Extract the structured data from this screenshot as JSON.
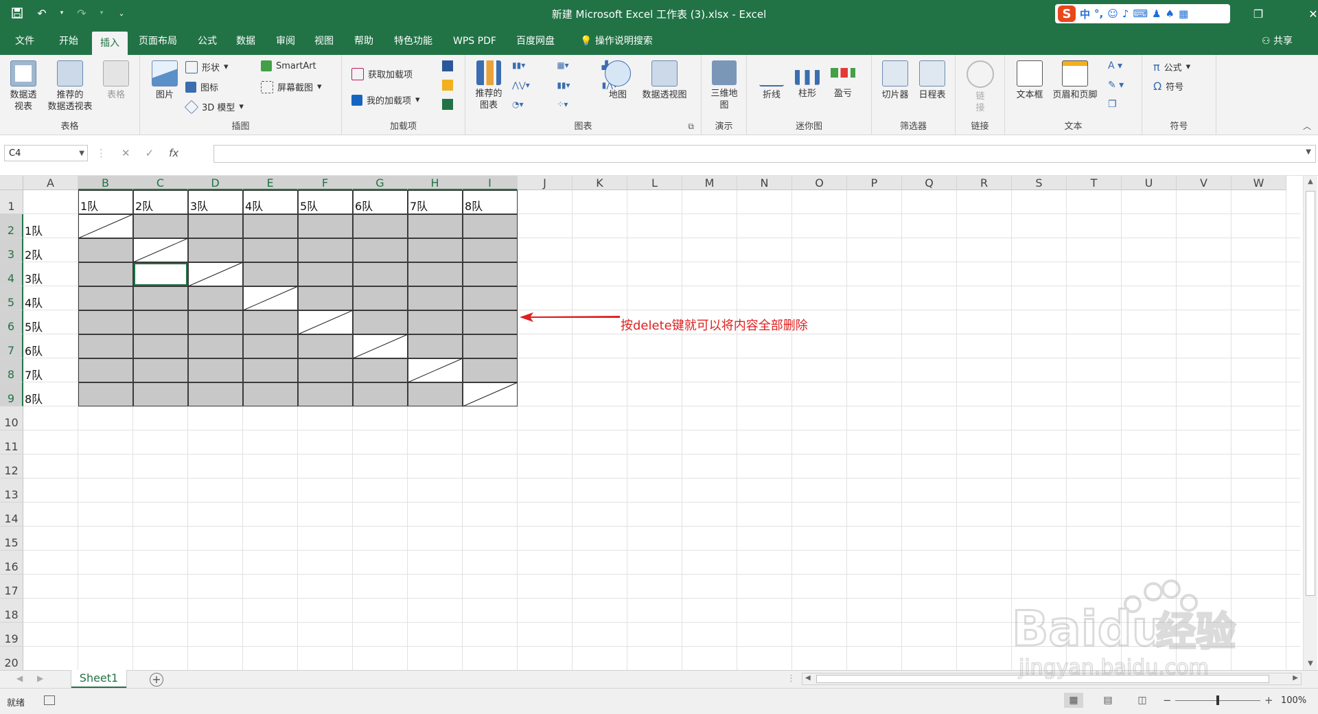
{
  "window": {
    "title": "新建 Microsoft Excel 工作表 (3).xlsx  -  Excel",
    "qat": [
      "save-icon",
      "undo-icon",
      "redo-icon",
      "customize-icon"
    ],
    "ime_logo": "S",
    "ime_label": "中",
    "ime_icons": [
      "°,",
      "☺",
      "🎤",
      "⌨",
      "👤",
      "👕",
      "▦"
    ]
  },
  "tabs": [
    "文件",
    "开始",
    "插入",
    "页面布局",
    "公式",
    "数据",
    "审阅",
    "视图",
    "帮助",
    "特色功能",
    "WPS PDF",
    "百度网盘"
  ],
  "active_tab": "插入",
  "tell_me": "操作说明搜索",
  "share": "共享",
  "ribbon": {
    "groups": {
      "tables": {
        "label": "表格",
        "pivot": "数据透\n视表",
        "recommended_pivot": "推荐的\n数据透视表",
        "table": "表格"
      },
      "illustrations": {
        "label": "插图",
        "picture": "图片",
        "shapes": "形状",
        "icons": "图标",
        "model3d": "3D 模型",
        "smartart": "SmartArt",
        "screenshot": "屏幕截图"
      },
      "addins": {
        "label": "加载项",
        "get": "获取加载项",
        "mine": "我的加载项"
      },
      "charts": {
        "label": "图表",
        "recommended": "推荐的\n图表",
        "maps": "地图",
        "pivotchart": "数据透视图"
      },
      "tours": {
        "label": "演示",
        "map3d": "三维地\n图"
      },
      "sparklines": {
        "label": "迷你图",
        "line": "折线",
        "column": "柱形",
        "winloss": "盈亏"
      },
      "filters": {
        "label": "筛选器",
        "slicer": "切片器",
        "timeline": "日程表"
      },
      "links": {
        "label": "链接",
        "link": "链\n接"
      },
      "text": {
        "label": "文本",
        "textbox": "文本框",
        "headerfooter": "页眉和页脚"
      },
      "symbols": {
        "label": "符号",
        "equation": "公式",
        "symbol": "符号"
      }
    }
  },
  "formula_bar": {
    "name_box": "C4",
    "fx": "fx",
    "content": ""
  },
  "columns": [
    "A",
    "B",
    "C",
    "D",
    "E",
    "F",
    "G",
    "H",
    "I",
    "J",
    "K",
    "L",
    "M",
    "N",
    "O",
    "P",
    "Q",
    "R",
    "S",
    "T",
    "U",
    "V",
    "W"
  ],
  "selected_columns": [
    "B",
    "C",
    "D",
    "E",
    "F",
    "G",
    "H",
    "I"
  ],
  "rows": [
    "1",
    "2",
    "3",
    "4",
    "5",
    "6",
    "7",
    "8",
    "9",
    "10",
    "11",
    "12",
    "13",
    "14",
    "15",
    "16",
    "17",
    "18",
    "19",
    "20"
  ],
  "selected_rows": [
    "2",
    "3",
    "4",
    "5",
    "6",
    "7",
    "8",
    "9"
  ],
  "table": {
    "header_row": [
      "1队",
      "2队",
      "3队",
      "4队",
      "5队",
      "6队",
      "7队",
      "8队"
    ],
    "row_labels": [
      "1队",
      "2队",
      "3队",
      "4队",
      "5队",
      "6队",
      "7队",
      "8队"
    ],
    "active_cell": "C4"
  },
  "annotation": "按delete键就可以将内容全部删除",
  "sheets": [
    "Sheet1"
  ],
  "status": {
    "ready": "就绪",
    "zoom": "100%"
  },
  "watermark": {
    "brand": "Baidu",
    "cn": "经验",
    "url": "jingyan.baidu.com"
  }
}
